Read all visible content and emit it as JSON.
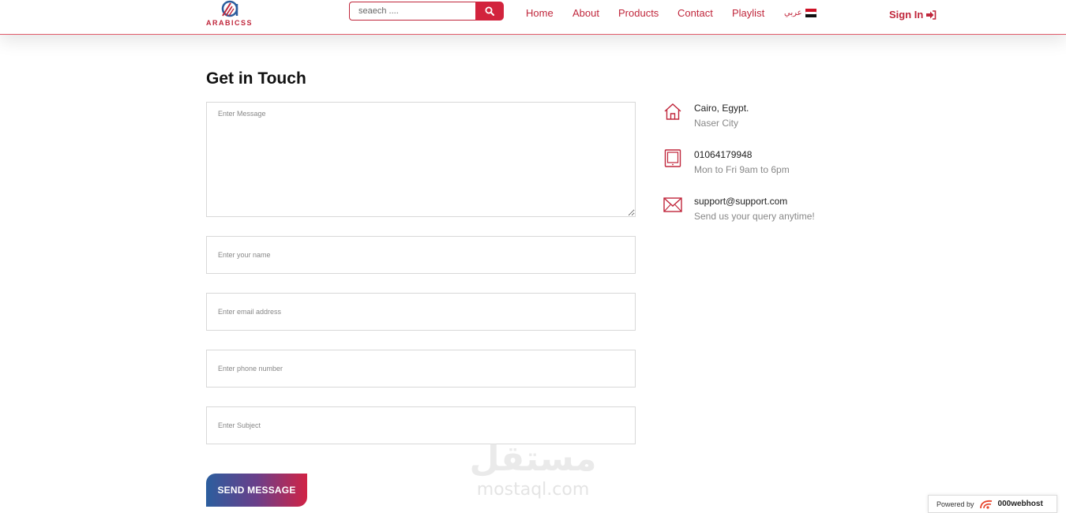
{
  "brand": {
    "logo_text": "ARABICSS",
    "accent": "#c0263b"
  },
  "search": {
    "placeholder": "seaech ...."
  },
  "nav": {
    "home": "Home",
    "about": "About",
    "products": "Products",
    "contact": "Contact",
    "playlist": "Playlist",
    "language": "عربي",
    "sign_in": "Sign In"
  },
  "form": {
    "title": "Get in Touch",
    "message_placeholder": "Enter Message",
    "name_placeholder": "Enter your name",
    "email_placeholder": "Enter email address",
    "phone_placeholder": "Enter phone number",
    "subject_placeholder": "Enter Subject",
    "submit_label": "SEND MESSAGE"
  },
  "contact_info": [
    {
      "icon": "home-icon",
      "title": "Cairo, Egypt.",
      "sub": "Naser City"
    },
    {
      "icon": "tablet-icon",
      "title": "01064179948",
      "sub": "Mon to Fri 9am to 6pm"
    },
    {
      "icon": "envelope-icon",
      "title": "support@support.com",
      "sub": "Send us your query anytime!"
    }
  ],
  "watermark": {
    "arabic": "مستقل",
    "latin": "mostaql.com"
  },
  "footer_badge": {
    "powered_by": "Powered by",
    "host": "000webhost"
  }
}
